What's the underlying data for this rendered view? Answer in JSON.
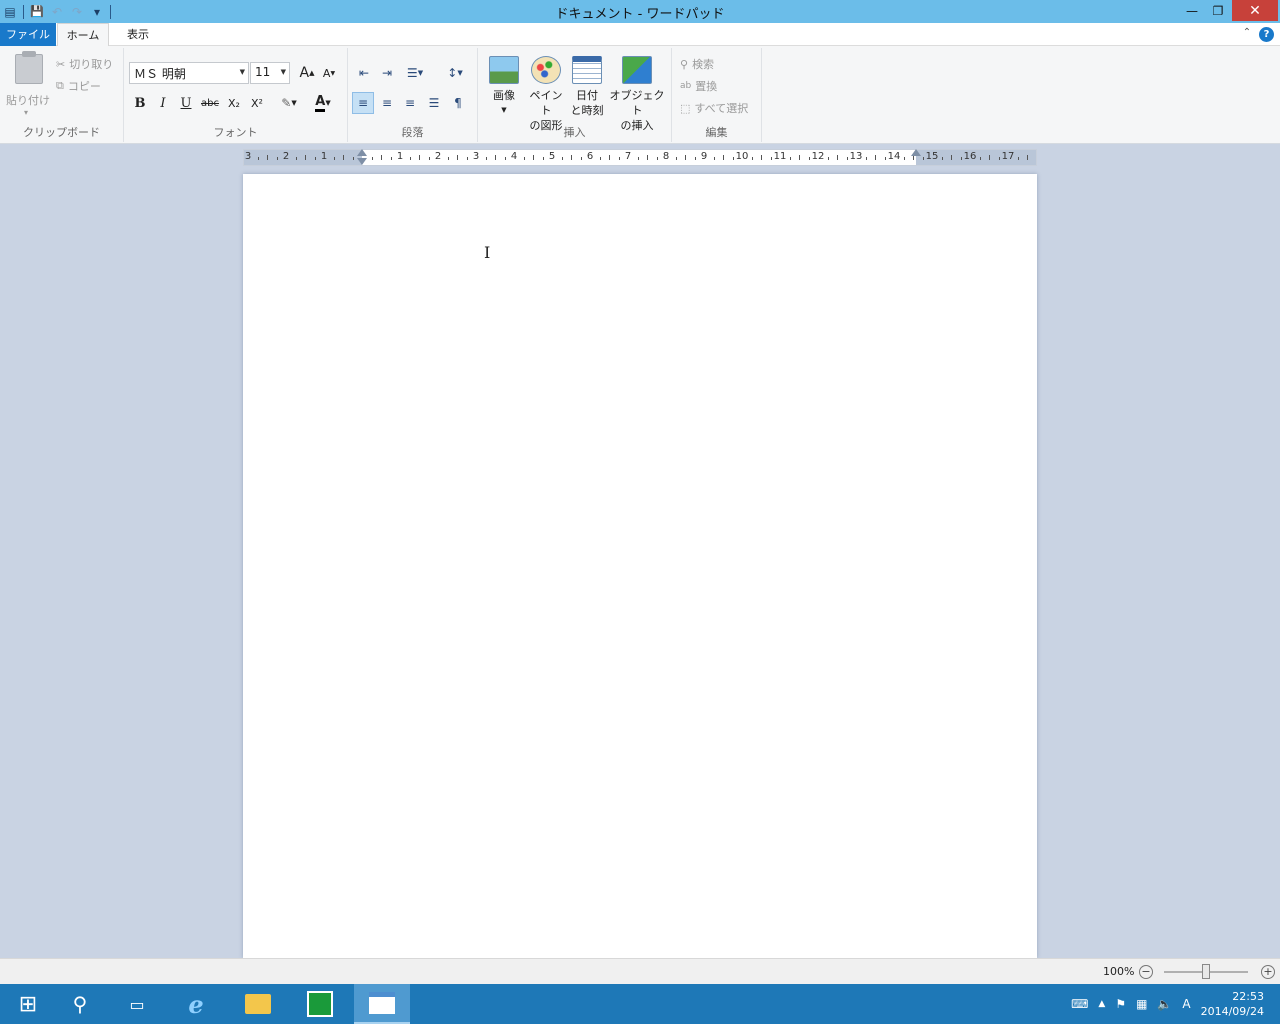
{
  "window": {
    "title": "ドキュメント - ワードパッド",
    "minimize_glyph": "—",
    "restore_glyph": "❐",
    "close_glyph": "✕"
  },
  "qat": {
    "app_glyph": "▤",
    "save_glyph": "💾",
    "undo_glyph": "↶",
    "redo_glyph": "↷",
    "customize_glyph": "▾"
  },
  "tabs": {
    "file": "ファイル",
    "home": "ホーム",
    "view": "表示",
    "help": "?"
  },
  "clipboard": {
    "paste": "貼り付け",
    "cut": "切り取り",
    "copy": "コピー",
    "group_label": "クリップボード"
  },
  "font": {
    "family": "ＭＳ 明朝",
    "size": "11",
    "grow": "A",
    "shrink": "A",
    "bold": "B",
    "italic": "I",
    "underline": "U",
    "strike": "abc",
    "subscript": "X₂",
    "superscript": "X²",
    "color_letter": "A",
    "group_label": "フォント"
  },
  "paragraph": {
    "group_label": "段落"
  },
  "insert": {
    "picture": "画像",
    "paint_line1": "ペイント",
    "paint_line2": "の図形",
    "datetime_line1": "日付",
    "datetime_line2": "と時刻",
    "object_line1": "オブジェクト",
    "object_line2": "の挿入",
    "group_label": "挿入"
  },
  "editing": {
    "find": "検索",
    "replace": "置換",
    "select_all": "すべて選択",
    "group_label": "編集"
  },
  "ruler": {
    "labels": [
      "3",
      "2",
      "1",
      "1",
      "2",
      "3",
      "4",
      "5",
      "6",
      "7",
      "8",
      "9",
      "10",
      "11",
      "12",
      "13",
      "14",
      "15",
      "16",
      "17"
    ]
  },
  "status": {
    "zoom": "100%",
    "zoom_out": "−",
    "zoom_in": "+"
  },
  "taskbar": {
    "clock_time": "22:53",
    "clock_date": "2014/09/24",
    "ime": "A"
  },
  "colors": {
    "title_bar": "#6bbde9",
    "file_tab": "#1979ca",
    "taskbar": "#1e78b7",
    "close_button": "#c7413a"
  }
}
